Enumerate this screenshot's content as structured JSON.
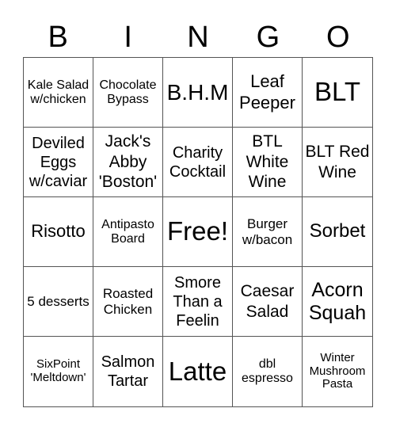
{
  "header": [
    "B",
    "I",
    "N",
    "G",
    "O"
  ],
  "cells": [
    "Kale Salad w/chicken",
    "Chocolate Bypass",
    "B.H.M",
    "Leaf Peeper",
    "BLT",
    "Deviled Eggs w/caviar",
    "Jack's Abby 'Boston'",
    "Charity Cocktail",
    "BTL White Wine",
    "BLT Red Wine",
    "Risotto",
    "Antipasto Board",
    "Free!",
    "Burger w/bacon",
    "Sorbet",
    "5 desserts",
    "Roasted Chicken",
    "Smore Than a Feelin",
    "Caesar Salad",
    "Acorn Squah",
    "SixPoint 'Meltdown'",
    "Salmon Tartar",
    "Latte",
    "dbl espresso",
    "Winter Mushroom Pasta"
  ]
}
